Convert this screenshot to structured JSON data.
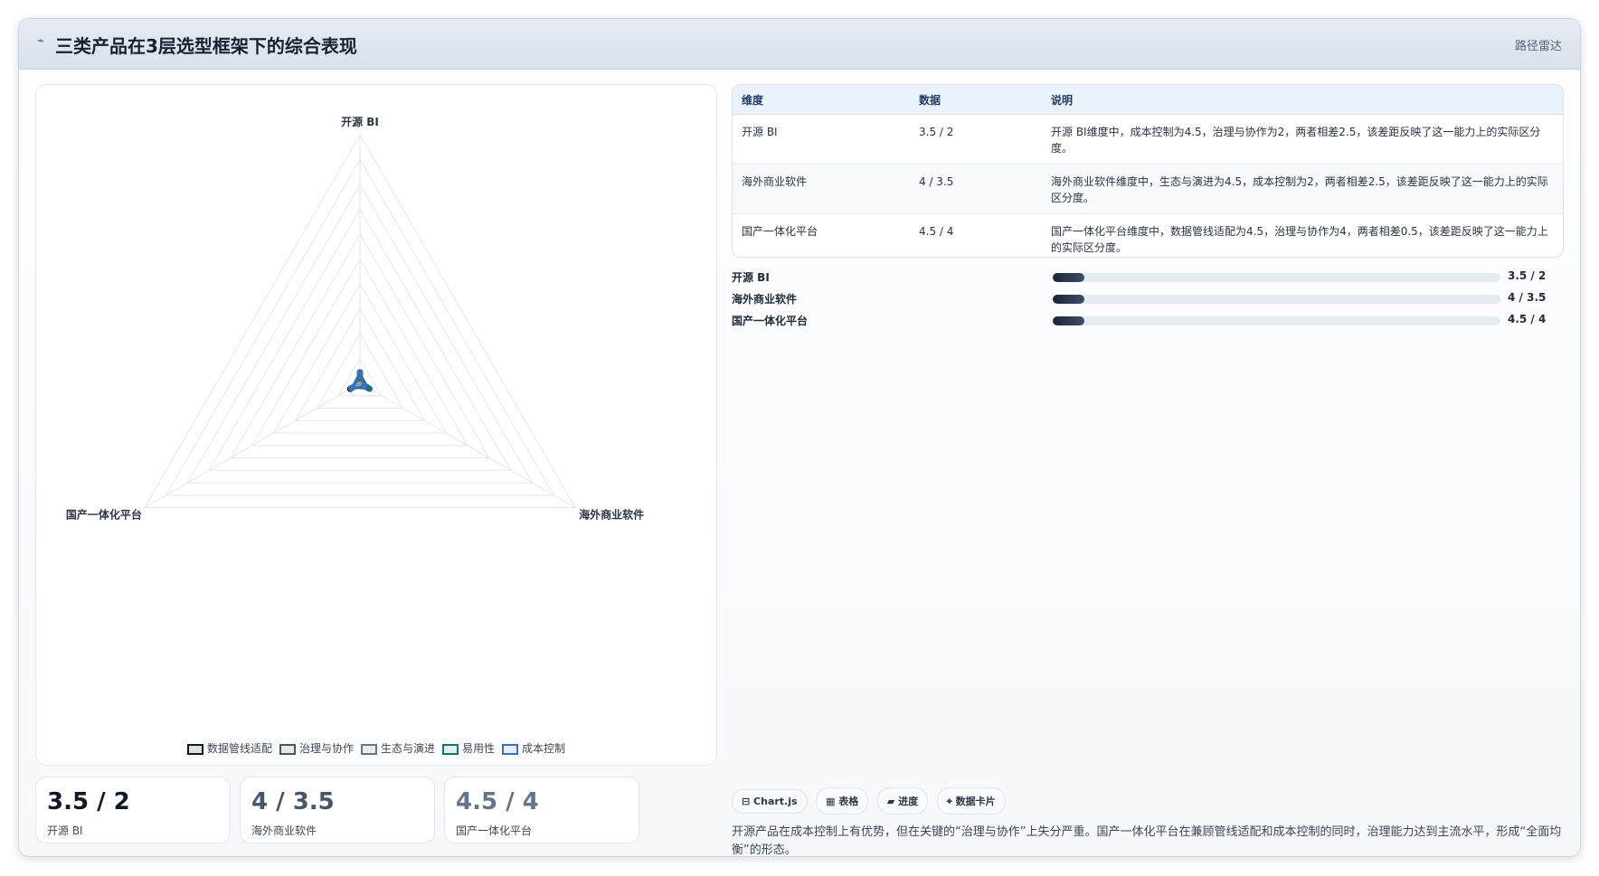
{
  "header": {
    "icon": "chart-icon",
    "title": "三类产品在3层选型框架下的综合表现",
    "tag": "路径雷达"
  },
  "chart_data": {
    "type": "radar",
    "axes": [
      "开源 BI",
      "海外商业软件",
      "国产一体化平台"
    ],
    "scale_max": 100,
    "rings": 10,
    "series": [
      {
        "name": "数据管线适配",
        "values": [
          2,
          3,
          4.5
        ],
        "stroke": "#111827",
        "fill": "#111827"
      },
      {
        "name": "治理与协作",
        "values": [
          2,
          2.5,
          4
        ],
        "stroke": "#475569",
        "fill": "#475569"
      },
      {
        "name": "生态与演进",
        "values": [
          3,
          4.5,
          3.5
        ],
        "stroke": "#64748b",
        "fill": "#64748b"
      },
      {
        "name": "易用性",
        "values": [
          4,
          4,
          3.5
        ],
        "stroke": "#0f766e",
        "fill": "#0f766e"
      },
      {
        "name": "成本控制",
        "values": [
          4.5,
          2,
          4
        ],
        "stroke": "#3b6fc4",
        "fill": "#3b6fc4"
      }
    ]
  },
  "stats": [
    {
      "value": "3.5 / 2",
      "label": "开源 BI",
      "color": "#111827"
    },
    {
      "value": "4 / 3.5",
      "label": "海外商业软件",
      "color": "#475569"
    },
    {
      "value": "4.5 / 4",
      "label": "国产一体化平台",
      "color": "#64748b"
    }
  ],
  "table": {
    "headers": [
      "维度",
      "数据",
      "说明"
    ],
    "rows": [
      {
        "dim": "开源 BI",
        "data": "3.5 / 2",
        "desc": "开源 BI维度中，成本控制为4.5，治理与协作为2，两者相差2.5，该差距反映了这一能力上的实际区分度。"
      },
      {
        "dim": "海外商业软件",
        "data": "4 / 3.5",
        "desc": "海外商业软件维度中，生态与演进为4.5，成本控制为2，两者相差2.5，该差距反映了这一能力上的实际区分度。"
      },
      {
        "dim": "国产一体化平台",
        "data": "4.5 / 4",
        "desc": "国产一体化平台维度中，数据管线适配为4.5，治理与协作为4，两者相差0.5，该差距反映了这一能力上的实际区分度。"
      }
    ]
  },
  "bars": [
    {
      "label": "开源 BI",
      "value": "3.5 / 2",
      "fill": 0.07
    },
    {
      "label": "海外商业软件",
      "value": "4 / 3.5",
      "fill": 0.07
    },
    {
      "label": "国产一体化平台",
      "value": "4.5 / 4",
      "fill": 0.07
    }
  ],
  "chips": [
    "⊟ Chart.js",
    "▦ 表格",
    "▰ 进度",
    "⌖ 数据卡片"
  ],
  "summary": "开源产品在成本控制上有优势，但在关键的“治理与协作”上失分严重。国产一体化平台在兼顾管线适配和成本控制的同时，治理能力达到主流水平，形成“全面均衡”的形态。"
}
